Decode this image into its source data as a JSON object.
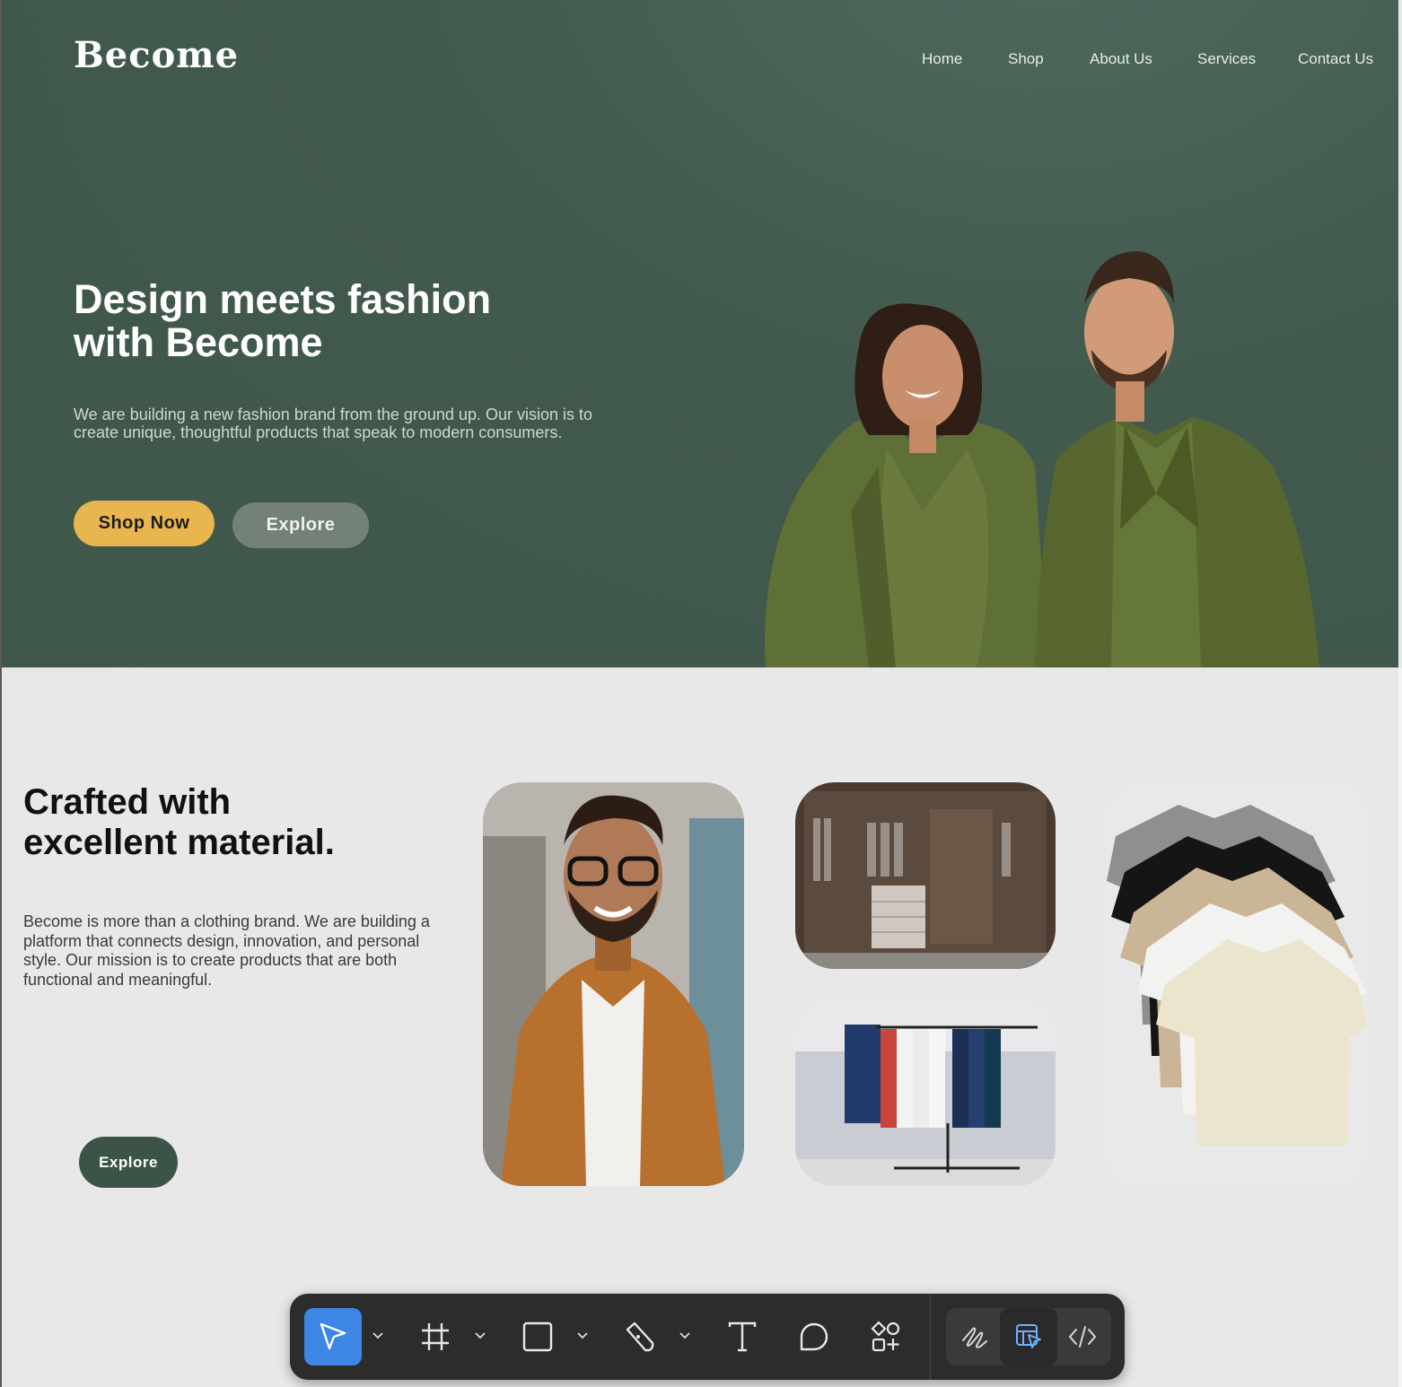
{
  "brand": {
    "logo": "Become"
  },
  "nav": {
    "items": [
      "Home",
      "Shop",
      "About Us",
      "Services",
      "Contact Us"
    ]
  },
  "hero": {
    "title_line1": "Design meets fashion",
    "title_line2": "with Become",
    "description": "We are building a new fashion brand from the ground up. Our vision is to create unique, thoughtful products that speak to modern consumers.",
    "primary_button": "Shop Now",
    "secondary_button": "Explore"
  },
  "section": {
    "title_line1": "Crafted with",
    "title_line2": "excellent material.",
    "description": "Become is more than a clothing brand. We are building a platform that connects design, innovation, and personal style. Our mission is to create products that are both functional and meaningful.",
    "button": "Explore"
  },
  "toolbar": {
    "tools": [
      "move-tool",
      "frame-tool",
      "shape-tool",
      "pen-tool",
      "text-tool",
      "comment-tool",
      "actions-tool"
    ],
    "modes": [
      "draw-mode",
      "design-mode",
      "dev-mode"
    ],
    "active_tool": "move-tool",
    "active_mode": "design-mode"
  },
  "colors": {
    "hero_bg": "#42594d",
    "accent_yellow": "#e9b54e",
    "explore_gray": "#738178",
    "dark_green": "#3c5447",
    "toolbar_bg": "#2c2c2c",
    "active_blue": "#3d86e6"
  }
}
